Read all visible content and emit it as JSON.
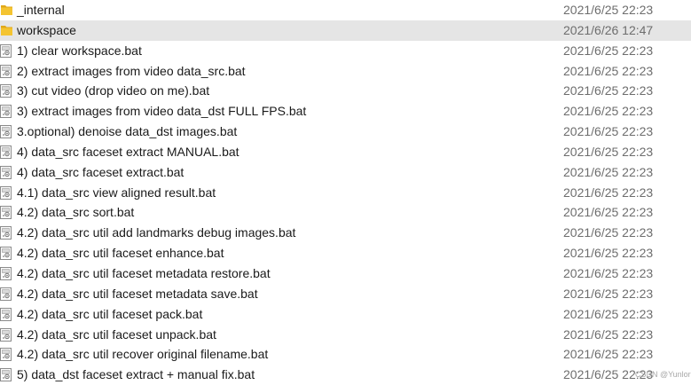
{
  "files": [
    {
      "name": "_internal",
      "date": "2021/6/25 22:23",
      "icon": "folder-icon",
      "selected": false
    },
    {
      "name": "workspace",
      "date": "2021/6/26 12:47",
      "icon": "folder-icon",
      "selected": true
    },
    {
      "name": "1) clear workspace.bat",
      "date": "2021/6/25 22:23",
      "icon": "batch-file-icon",
      "selected": false
    },
    {
      "name": "2) extract images from video data_src.bat",
      "date": "2021/6/25 22:23",
      "icon": "batch-file-icon",
      "selected": false
    },
    {
      "name": "3) cut video (drop video on me).bat",
      "date": "2021/6/25 22:23",
      "icon": "batch-file-icon",
      "selected": false
    },
    {
      "name": "3) extract images from video data_dst FULL FPS.bat",
      "date": "2021/6/25 22:23",
      "icon": "batch-file-icon",
      "selected": false
    },
    {
      "name": "3.optional) denoise data_dst images.bat",
      "date": "2021/6/25 22:23",
      "icon": "batch-file-icon",
      "selected": false
    },
    {
      "name": "4) data_src faceset extract MANUAL.bat",
      "date": "2021/6/25 22:23",
      "icon": "batch-file-icon",
      "selected": false
    },
    {
      "name": "4) data_src faceset extract.bat",
      "date": "2021/6/25 22:23",
      "icon": "batch-file-icon",
      "selected": false
    },
    {
      "name": "4.1) data_src view aligned result.bat",
      "date": "2021/6/25 22:23",
      "icon": "batch-file-icon",
      "selected": false
    },
    {
      "name": "4.2) data_src sort.bat",
      "date": "2021/6/25 22:23",
      "icon": "batch-file-icon",
      "selected": false
    },
    {
      "name": "4.2) data_src util add landmarks debug images.bat",
      "date": "2021/6/25 22:23",
      "icon": "batch-file-icon",
      "selected": false
    },
    {
      "name": "4.2) data_src util faceset enhance.bat",
      "date": "2021/6/25 22:23",
      "icon": "batch-file-icon",
      "selected": false
    },
    {
      "name": "4.2) data_src util faceset metadata restore.bat",
      "date": "2021/6/25 22:23",
      "icon": "batch-file-icon",
      "selected": false
    },
    {
      "name": "4.2) data_src util faceset metadata save.bat",
      "date": "2021/6/25 22:23",
      "icon": "batch-file-icon",
      "selected": false
    },
    {
      "name": "4.2) data_src util faceset pack.bat",
      "date": "2021/6/25 22:23",
      "icon": "batch-file-icon",
      "selected": false
    },
    {
      "name": "4.2) data_src util faceset unpack.bat",
      "date": "2021/6/25 22:23",
      "icon": "batch-file-icon",
      "selected": false
    },
    {
      "name": "4.2) data_src util recover original filename.bat",
      "date": "2021/6/25 22:23",
      "icon": "batch-file-icon",
      "selected": false
    },
    {
      "name": "5) data_dst faceset extract + manual fix.bat",
      "date": "2021/6/25 22:23",
      "icon": "batch-file-icon",
      "selected": false
    }
  ],
  "watermark": "CSDN @Yunlor",
  "colors": {
    "folder": "#f4c431",
    "folder_dark": "#e0a81a",
    "selected_row": "#e5e5e5",
    "date_text": "#6d6d6d"
  }
}
